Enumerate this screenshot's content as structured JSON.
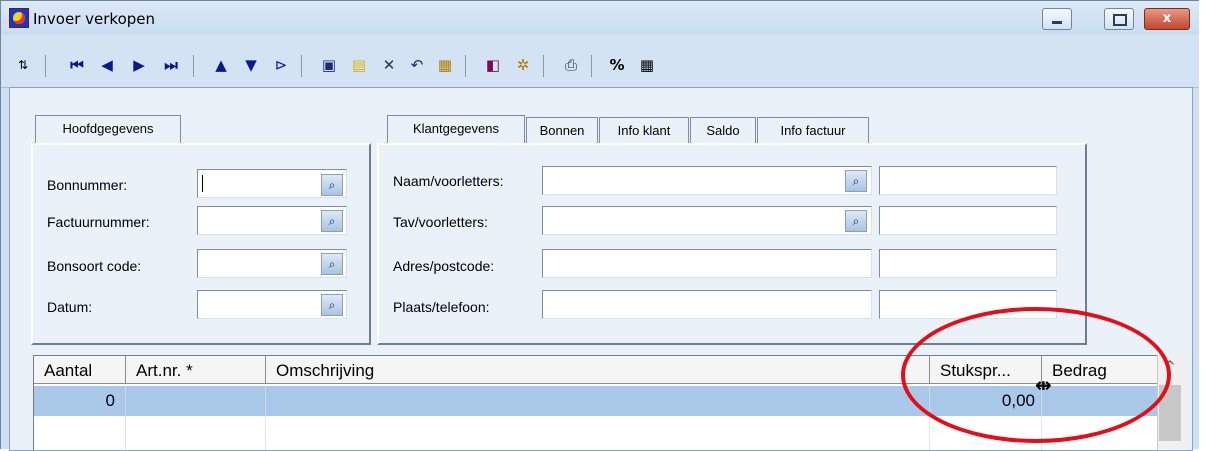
{
  "window": {
    "title": "Invoer verkopen",
    "close_label": "x"
  },
  "toolbar": {
    "icons": [
      "sort-icon",
      "first-record-icon",
      "prev-record-icon",
      "next-record-icon",
      "last-record-icon",
      "up-icon",
      "down-icon",
      "filter-icon",
      "save-icon",
      "new-icon",
      "delete-icon",
      "undo-icon",
      "copy-icon",
      "report-icon",
      "settings-icon",
      "print-icon",
      "percent-icon",
      "calculator-icon"
    ]
  },
  "left_panel": {
    "tab": "Hoofdgegevens",
    "fields": [
      {
        "label": "Bonnummer:",
        "value": ""
      },
      {
        "label": "Factuurnummer:",
        "value": ""
      },
      {
        "label": "Bonsoort code:",
        "value": ""
      },
      {
        "label": "Datum:",
        "value": ""
      }
    ]
  },
  "right_panel": {
    "tabs": [
      "Klantgegevens",
      "Bonnen",
      "Info klant",
      "Saldo",
      "Info factuur"
    ],
    "fields": [
      {
        "label": "Naam/voorletters:",
        "value": "",
        "extra": ""
      },
      {
        "label": "Tav/voorletters:",
        "value": "",
        "extra": ""
      },
      {
        "label": "Adres/postcode:",
        "value": "",
        "extra": ""
      },
      {
        "label": "Plaats/telefoon:",
        "value": "",
        "extra": ""
      }
    ]
  },
  "grid": {
    "columns": [
      "Aantal",
      "Art.nr. *",
      "Omschrijving",
      "Stukspr...",
      "Bedrag"
    ],
    "rows": [
      {
        "aantal": "0",
        "artnr": "",
        "omschrijving": "",
        "stukspr": "0,00",
        "bedrag": ""
      }
    ]
  },
  "colors": {
    "selected_row": "#a9c8ea",
    "annotation": "#e0101a"
  }
}
